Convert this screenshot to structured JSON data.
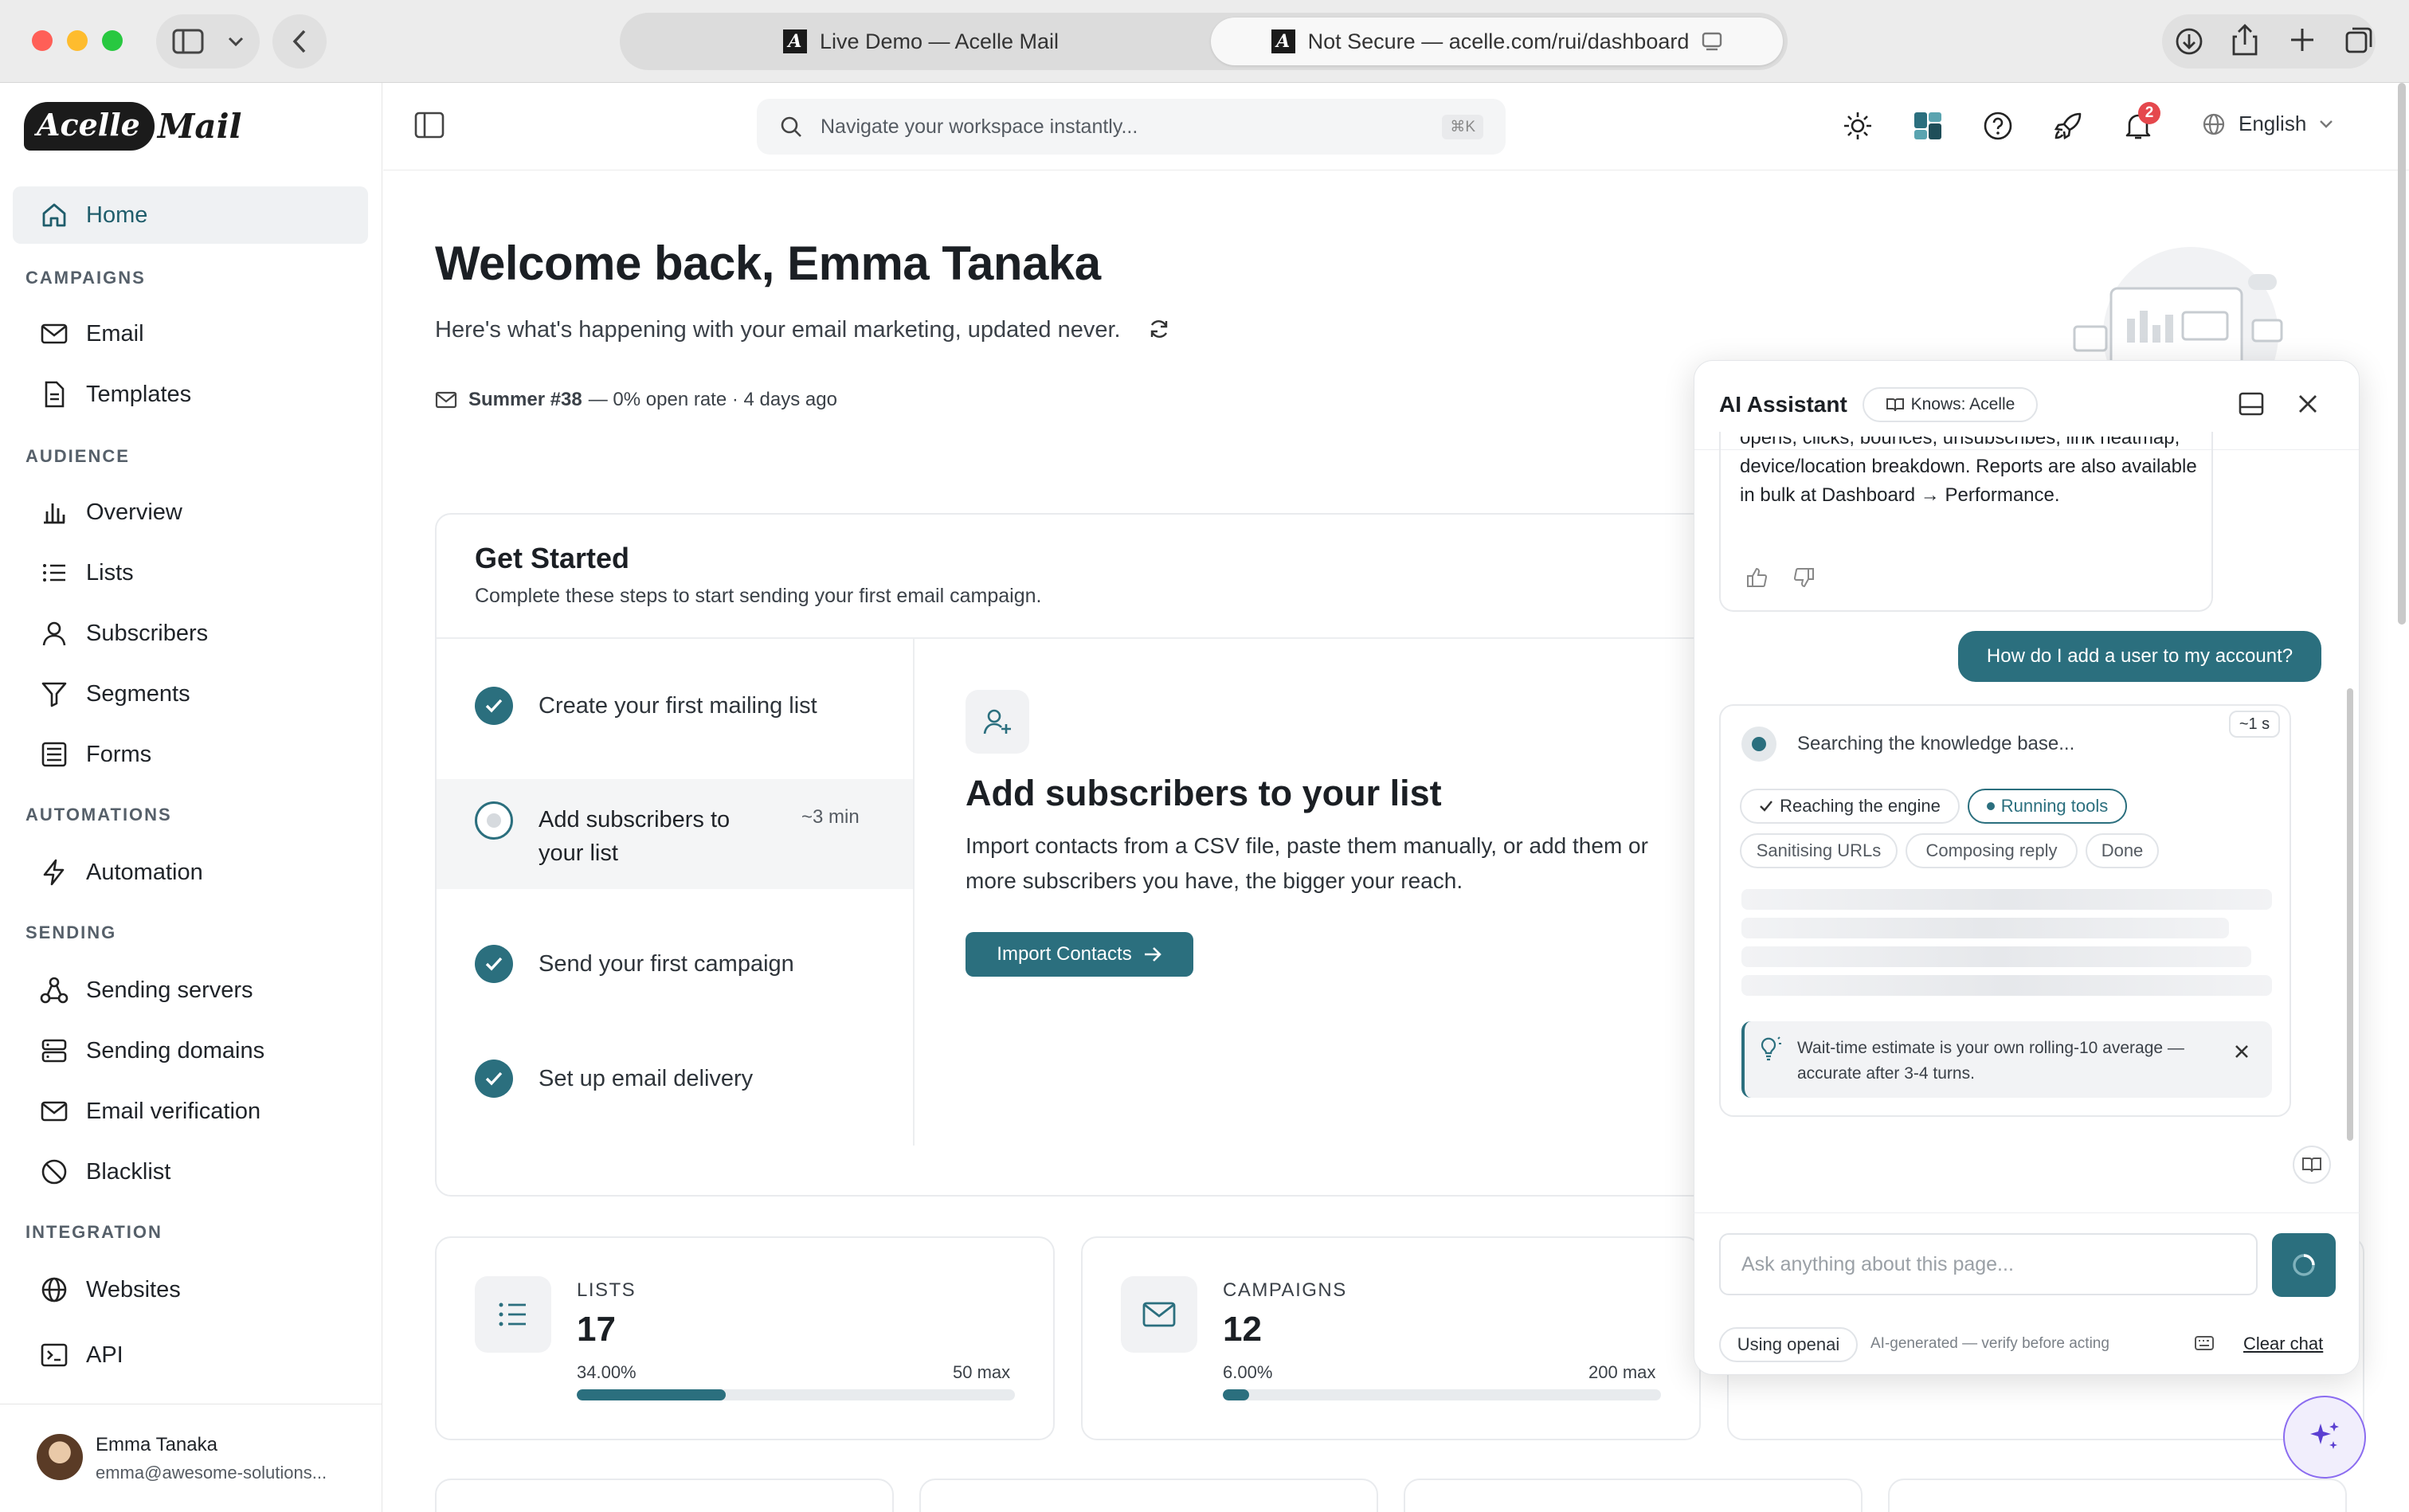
{
  "browser": {
    "tabs": [
      {
        "label": "Live Demo — Acelle Mail"
      },
      {
        "label": "Not Secure — acelle.com/rui/dashboard"
      }
    ]
  },
  "app": {
    "logo_left": "Acelle",
    "logo_right": "Mail",
    "search_placeholder": "Navigate your workspace instantly...",
    "search_shortcut": "⌘K",
    "notification_count": "2",
    "language": "English"
  },
  "sidebar": {
    "home": "Home",
    "sections": {
      "campaigns": "CAMPAIGNS",
      "audience": "AUDIENCE",
      "automations": "AUTOMATIONS",
      "sending": "SENDING",
      "integration": "INTEGRATION"
    },
    "items": {
      "email": "Email",
      "templates": "Templates",
      "overview": "Overview",
      "lists": "Lists",
      "subscribers": "Subscribers",
      "segments": "Segments",
      "forms": "Forms",
      "automation": "Automation",
      "sending_servers": "Sending servers",
      "sending_domains": "Sending domains",
      "email_verification": "Email verification",
      "blacklist": "Blacklist",
      "websites": "Websites",
      "api": "API"
    },
    "user": {
      "name": "Emma Tanaka",
      "email": "emma@awesome-solutions..."
    }
  },
  "main": {
    "welcome": "Welcome back, Emma Tanaka",
    "subtitle": "Here's what's happening with your email marketing, updated never.",
    "recent_campaign": {
      "name": "Summer #38",
      "detail": "— 0% open rate · 4 days ago"
    },
    "get_started": {
      "title": "Get Started",
      "subtitle": "Complete these steps to start sending your first email campaign.",
      "steps": [
        {
          "label": "Create your first mailing list",
          "done": true
        },
        {
          "label": "Add subscribers to your list",
          "done": false,
          "eta": "~3 min"
        },
        {
          "label": "Send your first campaign",
          "done": true
        },
        {
          "label": "Set up email delivery",
          "done": true
        }
      ],
      "detail": {
        "title": "Add subscribers to your list",
        "text_line1": "Import contacts from a CSV file, paste them manually, or add them or",
        "text_line2": "more subscribers you have, the bigger your reach.",
        "button": "Import Contacts"
      }
    },
    "stats": [
      {
        "label": "LISTS",
        "value": "17",
        "percent": "34.00%",
        "max": "50 max",
        "fill": 0.34
      },
      {
        "label": "CAMPAIGNS",
        "value": "12",
        "percent": "6.00%",
        "max": "200 max",
        "fill": 0.06
      }
    ]
  },
  "ai_panel": {
    "title": "AI Assistant",
    "knows": "Knows: Acelle",
    "assistant_message": "opens, clicks, bounces, unsubscribes, link heatmap, device/location breakdown. Reports are also available in bulk at Dashboard → Performance.",
    "user_message": "How do I add a user to my account?",
    "status": "Searching the knowledge base...",
    "elapsed": "~1 s",
    "stages": [
      "Reaching the engine",
      "Running tools",
      "Sanitising URLs",
      "Composing reply",
      "Done"
    ],
    "tip": "Wait-time estimate is your own rolling-10 average — accurate after 3-4 turns.",
    "input_placeholder": "Ask anything about this page...",
    "provider": "Using openai",
    "disclaimer": "AI-generated — verify before acting",
    "clear": "Clear chat"
  }
}
